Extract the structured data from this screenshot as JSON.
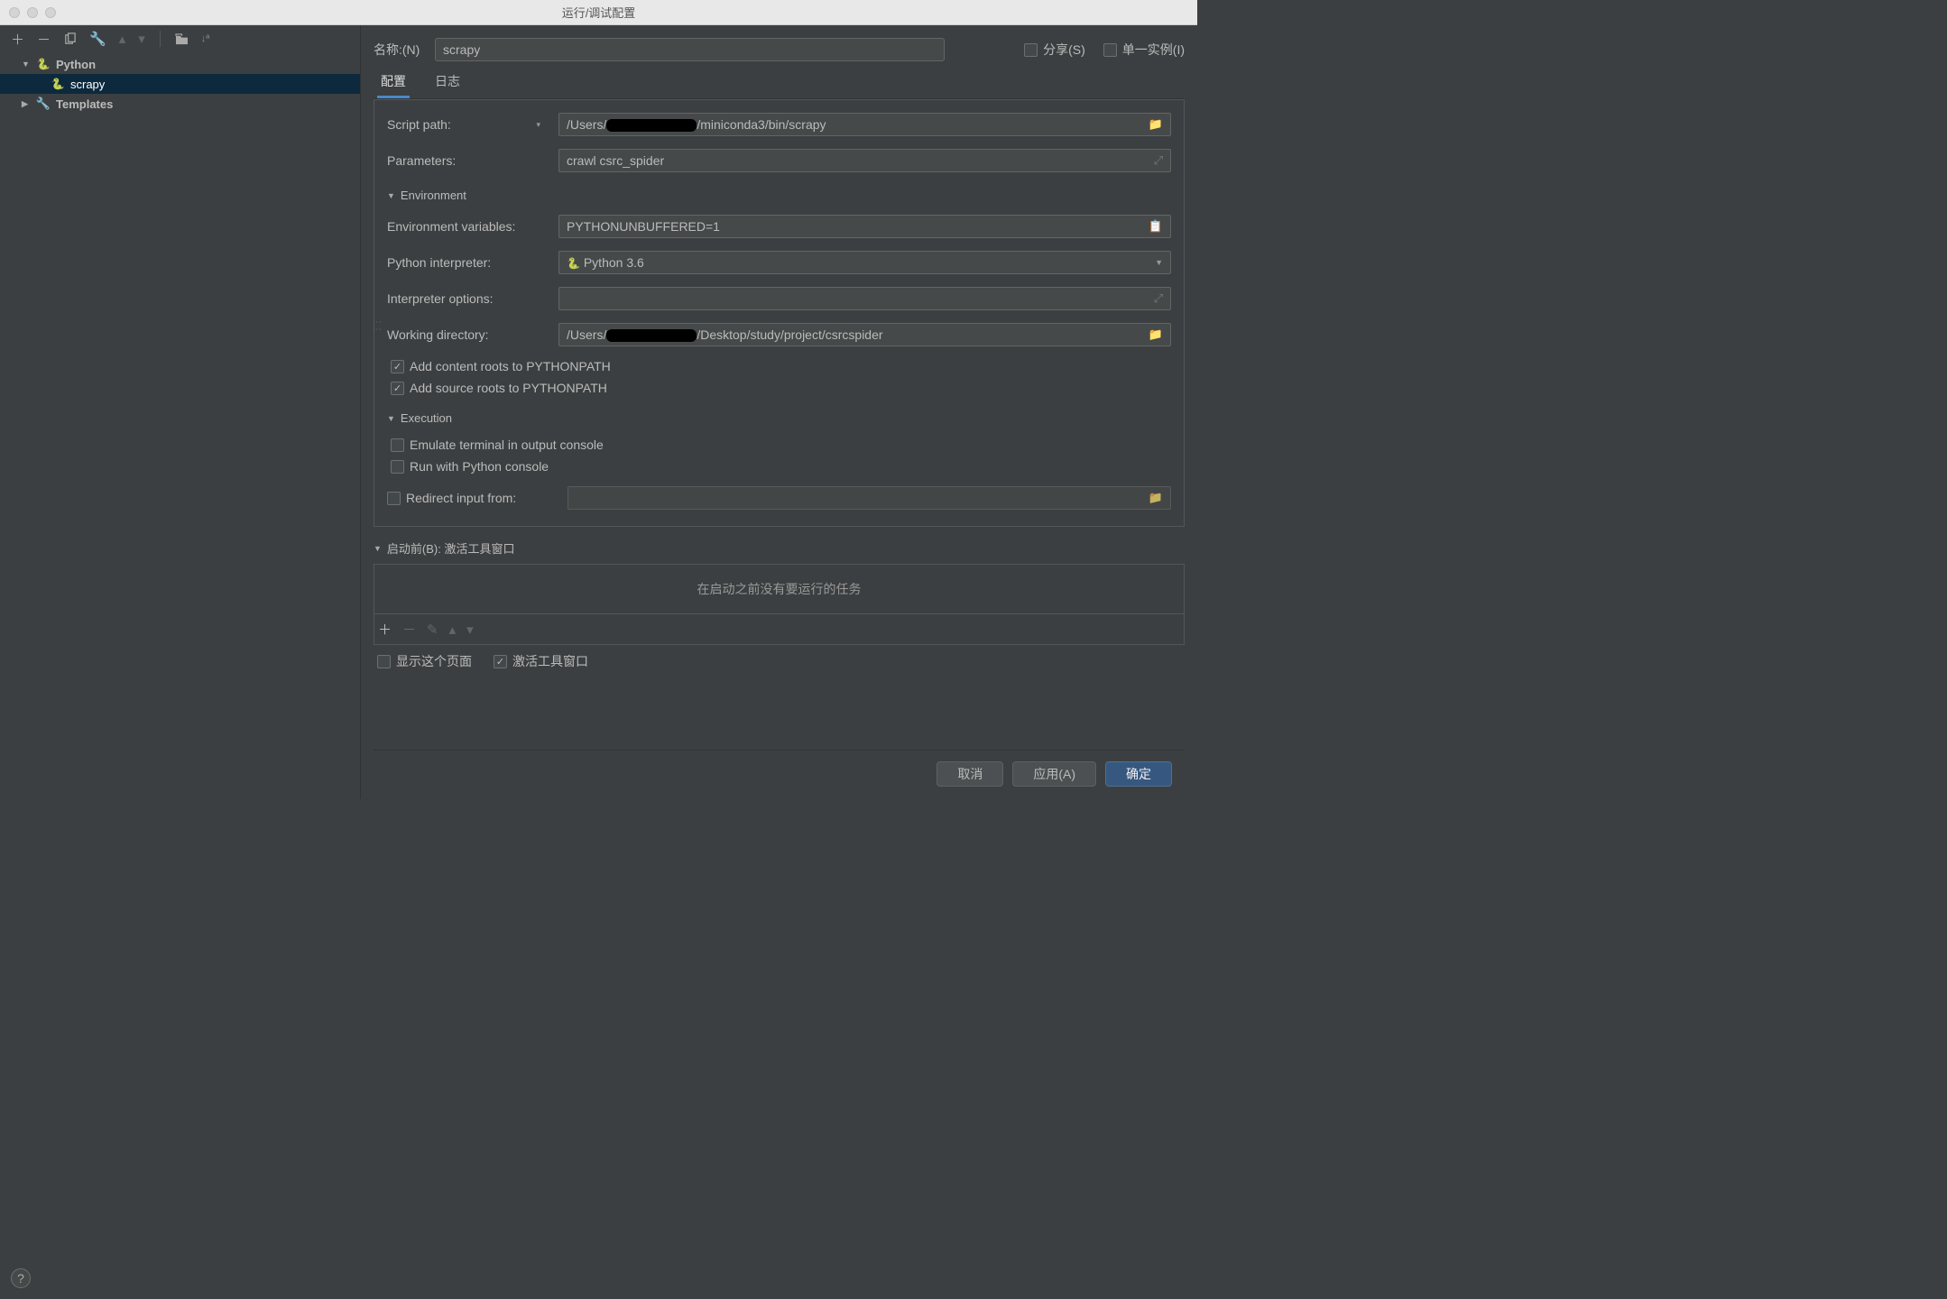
{
  "window_title": "运行/调试配置",
  "toolbar_icons": [
    "add",
    "remove",
    "copy",
    "wrench",
    "up",
    "down",
    "sep",
    "folder",
    "sort"
  ],
  "tree": {
    "python_group": "Python",
    "scrapy_item": "scrapy",
    "templates_group": "Templates"
  },
  "name": {
    "label": "名称:(N)",
    "value": "scrapy"
  },
  "share": {
    "label": "分享(S)",
    "checked": false
  },
  "single_instance": {
    "label": "单一实例(I)",
    "checked": false
  },
  "tabs": {
    "config": "配置",
    "log": "日志"
  },
  "form": {
    "script_path": {
      "label": "Script path:",
      "value_prefix": "/Users/",
      "value_suffix": "/miniconda3/bin/scrapy"
    },
    "parameters": {
      "label": "Parameters:",
      "value": "crawl csrc_spider"
    },
    "env_section": "Environment",
    "env_vars": {
      "label": "Environment variables:",
      "value": "PYTHONUNBUFFERED=1"
    },
    "interpreter": {
      "label": "Python interpreter:",
      "value": "Python 3.6"
    },
    "interp_options": {
      "label": "Interpreter options:",
      "value": ""
    },
    "working_dir": {
      "label": "Working directory:",
      "value_prefix": "/Users/",
      "value_suffix": "/Desktop/study/project/csrcspider"
    },
    "add_content_roots": {
      "label": "Add content roots to PYTHONPATH",
      "checked": true
    },
    "add_source_roots": {
      "label": "Add source roots to PYTHONPATH",
      "checked": true
    },
    "exec_section": "Execution",
    "emulate_terminal": {
      "label": "Emulate terminal in output console",
      "checked": false
    },
    "run_python_console": {
      "label": "Run with Python console",
      "checked": false
    },
    "redirect_input": {
      "label": "Redirect input from:",
      "checked": false,
      "value": ""
    }
  },
  "before_launch": {
    "header": "启动前(B): 激活工具窗口",
    "empty_text": "在启动之前没有要运行的任务",
    "show_page": {
      "label": "显示这个页面",
      "checked": false
    },
    "activate_tool": {
      "label": "激活工具窗口",
      "checked": true
    }
  },
  "buttons": {
    "cancel": "取消",
    "apply": "应用(A)",
    "ok": "确定"
  },
  "help": "?"
}
